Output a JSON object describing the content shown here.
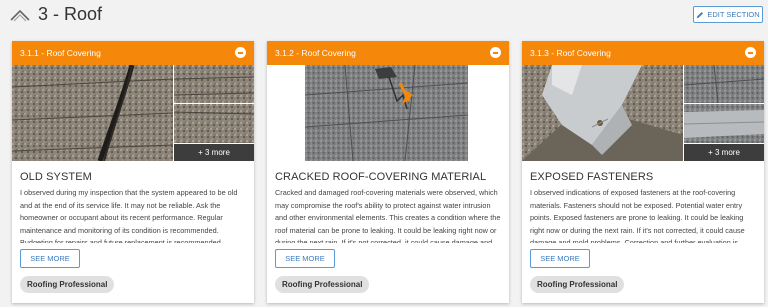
{
  "section": {
    "title": "3 - Roof",
    "edit_label": "EDIT SECTION"
  },
  "cards": [
    {
      "id": "3.1.1 - Roof Covering",
      "title": "OLD SYSTEM",
      "text": "I observed during my inspection that the system appeared to be old and at the end of its service life. It may not be reliable. Ask the homeowner or occupant about its recent performance. Regular maintenance and monitoring of its condition is recommended. Budgeting for repairs and future replacement is recommended.",
      "more_label": "+ 3 more",
      "see_more": "SEE MORE",
      "badge": "Roofing Professional"
    },
    {
      "id": "3.1.2 - Roof Covering",
      "title": "CRACKED ROOF-COVERING MATERIAL",
      "text": "Cracked and damaged roof-covering materials were observed, which may compromise the roof's ability to protect against water intrusion and other environmental elements. This creates a condition where the roof material can be prone to leaking. It could be leaking right now or during the next rain. If it's not corrected, it could cause damage and mold problems.",
      "see_more": "SEE MORE",
      "badge": "Roofing Professional"
    },
    {
      "id": "3.1.3 - Roof Covering",
      "title": "EXPOSED FASTENERS",
      "text": "I observed indications of exposed fasteners at the roof-covering materials. Fasteners should not be exposed. Potential water entry points. Exposed fasteners are prone to leaking. It could be leaking right now or during the next rain. If it's not corrected, it could cause damage and mold problems. Correction and further evaluation is recommended.",
      "more_label": "+ 3 more",
      "see_more": "SEE MORE",
      "badge": "Roofing Professional"
    }
  ],
  "colors": {
    "header_orange": "#f5870a",
    "link_blue": "#3a7bbf",
    "badge_gray": "#e0e0e0"
  }
}
